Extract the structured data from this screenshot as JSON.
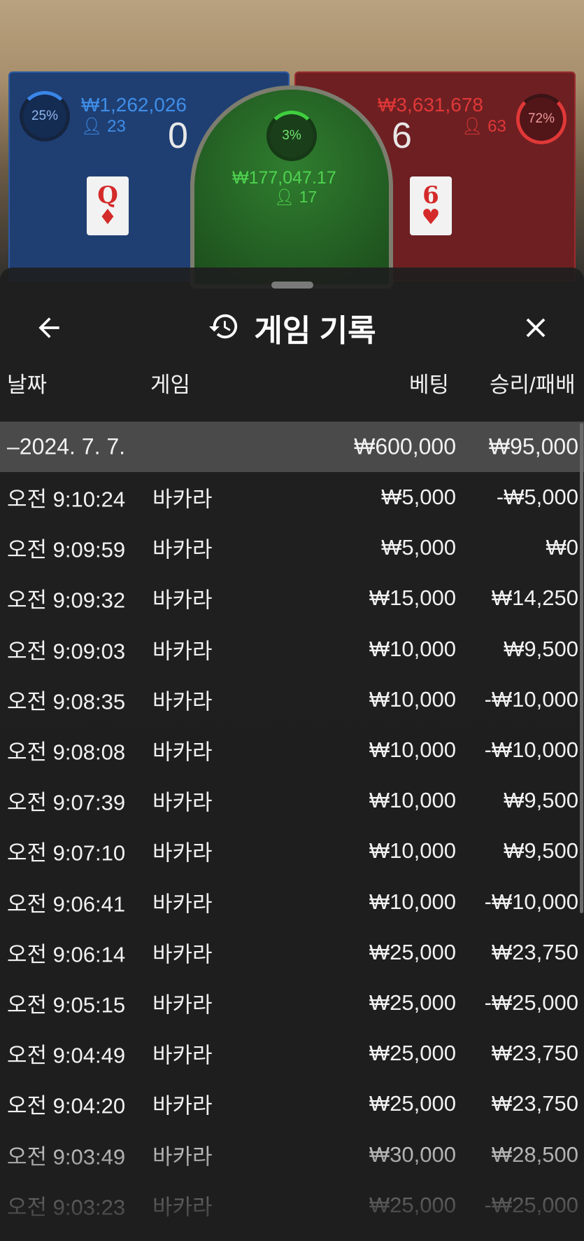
{
  "background": {
    "player": {
      "percent": "25%",
      "amount": "₩1,262,026",
      "count": "23",
      "score": "0",
      "card": {
        "rank": "Q",
        "suit": "♦"
      }
    },
    "banker": {
      "percent": "72%",
      "amount": "₩3,631,678",
      "count": "63",
      "score": "6",
      "card": {
        "rank": "6",
        "suit": "♥"
      }
    },
    "tie": {
      "percent": "3%",
      "amount": "₩177,047.17",
      "count": "17"
    },
    "colors": {
      "player": "#1f3f73",
      "banker": "#6e1f22",
      "tie": "#2f7d2f"
    }
  },
  "sheet": {
    "title": "게임 기록",
    "icons": {
      "back": "arrow-left-icon",
      "history": "history-icon",
      "close": "close-icon"
    },
    "columns": {
      "date": "날짜",
      "game": "게임",
      "bet": "베팅",
      "win": "승리/패배"
    },
    "summary": {
      "date": "–2024. 7. 7.",
      "bet": "₩600,000",
      "win": "₩95,000"
    },
    "rows": [
      {
        "time": "오전 9:10:24",
        "game": "바카라",
        "bet": "₩5,000",
        "win": "-₩5,000"
      },
      {
        "time": "오전 9:09:59",
        "game": "바카라",
        "bet": "₩5,000",
        "win": "₩0"
      },
      {
        "time": "오전 9:09:32",
        "game": "바카라",
        "bet": "₩15,000",
        "win": "₩14,250"
      },
      {
        "time": "오전 9:09:03",
        "game": "바카라",
        "bet": "₩10,000",
        "win": "₩9,500"
      },
      {
        "time": "오전 9:08:35",
        "game": "바카라",
        "bet": "₩10,000",
        "win": "-₩10,000"
      },
      {
        "time": "오전 9:08:08",
        "game": "바카라",
        "bet": "₩10,000",
        "win": "-₩10,000"
      },
      {
        "time": "오전 9:07:39",
        "game": "바카라",
        "bet": "₩10,000",
        "win": "₩9,500"
      },
      {
        "time": "오전 9:07:10",
        "game": "바카라",
        "bet": "₩10,000",
        "win": "₩9,500"
      },
      {
        "time": "오전 9:06:41",
        "game": "바카라",
        "bet": "₩10,000",
        "win": "-₩10,000"
      },
      {
        "time": "오전 9:06:14",
        "game": "바카라",
        "bet": "₩25,000",
        "win": "₩23,750"
      },
      {
        "time": "오전 9:05:15",
        "game": "바카라",
        "bet": "₩25,000",
        "win": "-₩25,000"
      },
      {
        "time": "오전 9:04:49",
        "game": "바카라",
        "bet": "₩25,000",
        "win": "₩23,750"
      },
      {
        "time": "오전 9:04:20",
        "game": "바카라",
        "bet": "₩25,000",
        "win": "₩23,750"
      },
      {
        "time": "오전 9:03:49",
        "game": "바카라",
        "bet": "₩30,000",
        "win": "₩28,500"
      },
      {
        "time": "오전 9:03:23",
        "game": "바카라",
        "bet": "₩25,000",
        "win": "-₩25,000"
      }
    ]
  }
}
